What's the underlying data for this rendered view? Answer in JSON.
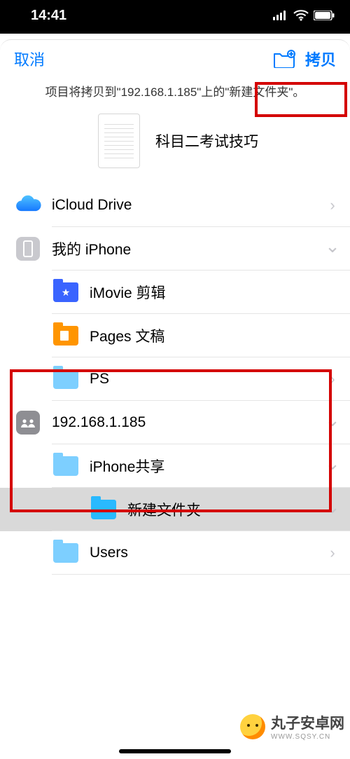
{
  "statusbar": {
    "time": "14:41"
  },
  "nav": {
    "cancel": "取消",
    "copy": "拷贝"
  },
  "subtitle": "项目将拷贝到\"192.168.1.185\"上的\"新建文件夹\"。",
  "file": {
    "title": "科目二考试技巧"
  },
  "locations": {
    "icloud": "iCloud Drive",
    "myiphone": "我的 iPhone",
    "imovie": "iMovie 剪辑",
    "pages": "Pages 文稿",
    "ps": "PS",
    "server": "192.168.1.185",
    "share": "iPhone共享",
    "newfolder": "新建文件夹",
    "users": "Users"
  },
  "watermark": {
    "name": "丸子安卓网",
    "url": "WWW.SQSY.CN"
  }
}
